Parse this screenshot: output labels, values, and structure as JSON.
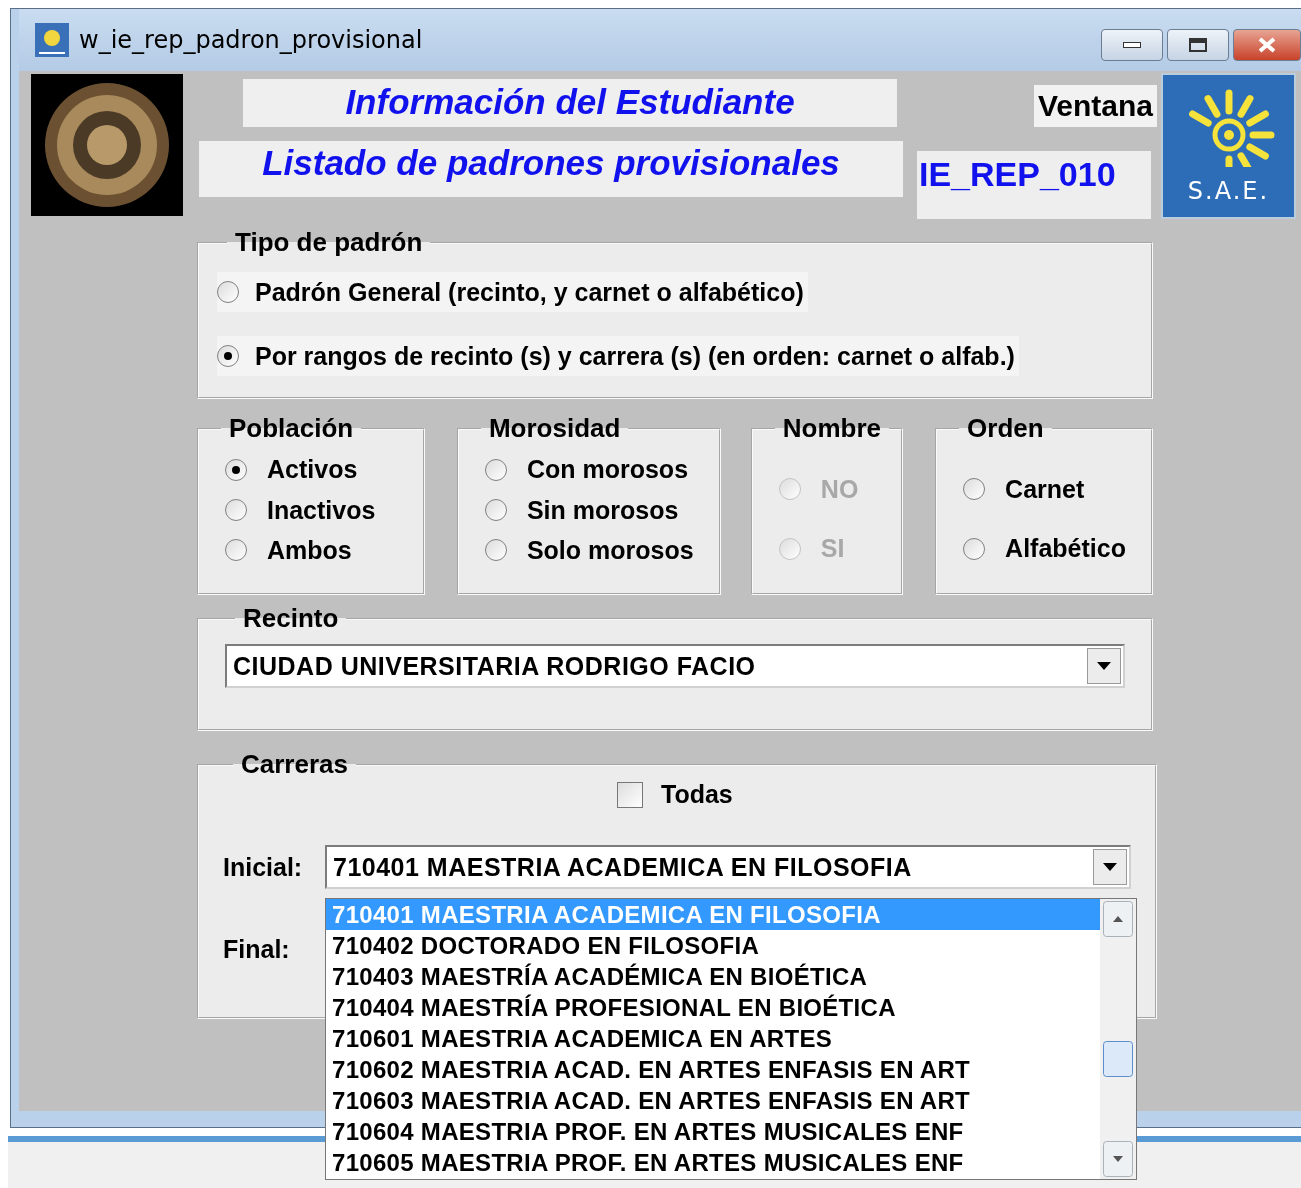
{
  "window": {
    "title": "w_ie_rep_padron_provisional"
  },
  "header": {
    "title": "Información del Estudiante",
    "subtitle": "Listado de padrones provisionales",
    "window_label": "Ventana",
    "window_code": "IE_REP_010",
    "logo_text": "S.A.E."
  },
  "tipo_padron": {
    "title": "Tipo de padrón",
    "options": [
      {
        "label": "Padrón General (recinto, y carnet o alfabético)",
        "selected": false
      },
      {
        "label": "Por rangos de recinto (s) y carrera (s) (en orden: carnet o alfab.)",
        "selected": true
      }
    ]
  },
  "option_groups": [
    {
      "title": "Población",
      "disabled": false,
      "options": [
        {
          "label": "Activos",
          "selected": true
        },
        {
          "label": "Inactivos",
          "selected": false
        },
        {
          "label": "Ambos",
          "selected": false
        }
      ]
    },
    {
      "title": "Morosidad",
      "disabled": false,
      "options": [
        {
          "label": "Con morosos",
          "selected": false
        },
        {
          "label": "Sin morosos",
          "selected": false
        },
        {
          "label": "Solo morosos",
          "selected": false
        }
      ]
    },
    {
      "title": "Nombre",
      "disabled": true,
      "options": [
        {
          "label": "NO",
          "selected": false
        },
        {
          "label": "SI",
          "selected": false
        }
      ]
    },
    {
      "title": "Orden",
      "disabled": false,
      "options": [
        {
          "label": "Carnet",
          "selected": false
        },
        {
          "label": "Alfabético",
          "selected": false
        }
      ]
    }
  ],
  "recinto": {
    "title": "Recinto",
    "value": "CIUDAD UNIVERSITARIA RODRIGO FACIO"
  },
  "carreras": {
    "title": "Carreras",
    "todas": {
      "label": "Todas",
      "checked": false
    },
    "inicial": {
      "label": "Inicial:",
      "value": "710401 MAESTRIA ACADEMICA EN FILOSOFIA"
    },
    "final": {
      "label": "Final:"
    },
    "dropdown_items": [
      {
        "label": "710401 MAESTRIA ACADEMICA EN FILOSOFIA",
        "selected": true
      },
      {
        "label": "710402 DOCTORADO EN FILOSOFIA",
        "selected": false
      },
      {
        "label": "710403 MAESTRÍA ACADÉMICA EN BIOÉTICA",
        "selected": false
      },
      {
        "label": "710404 MAESTRÍA PROFESIONAL EN BIOÉTICA",
        "selected": false
      },
      {
        "label": "710601 MAESTRIA ACADEMICA EN ARTES",
        "selected": false
      },
      {
        "label": "710602 MAESTRIA ACAD. EN ARTES ENFASIS EN ART",
        "selected": false
      },
      {
        "label": "710603 MAESTRIA ACAD. EN ARTES ENFASIS EN ART",
        "selected": false
      },
      {
        "label": "710604 MAESTRIA PROF. EN ARTES MUSICALES ENF",
        "selected": false
      },
      {
        "label": "710605 MAESTRIA PROF. EN ARTES MUSICALES ENF",
        "selected": false
      }
    ]
  }
}
